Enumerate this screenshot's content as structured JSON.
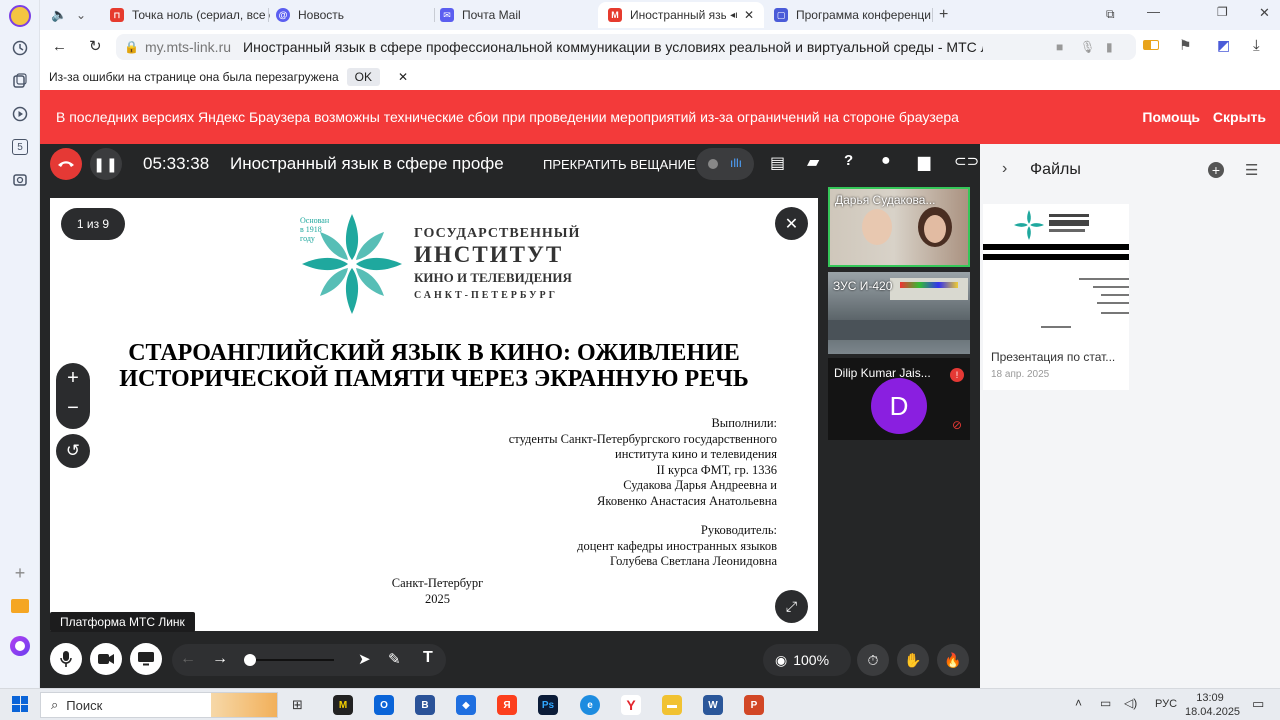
{
  "browser": {
    "tabs": [
      {
        "label": "Точка ноль (сериал, все с",
        "fav": "#e63b2e",
        "glyph": "⊓"
      },
      {
        "label": "Новость",
        "fav": "#5b5ef0",
        "glyph": "@"
      },
      {
        "label": "Почта Mail",
        "fav": "#5b5ef0",
        "glyph": "✉"
      },
      {
        "label": "Иностранный язык",
        "fav": "#e63b2e",
        "glyph": "M"
      },
      {
        "label": "Программа конференци",
        "fav": "#4a5bd8",
        "glyph": "▢"
      }
    ],
    "url_host": "my.mts-link.ru",
    "page_title": "Иностранный язык в сфере профессиональной коммуникации в условиях реальной и виртуальной среды - МТС Л...",
    "infobar_text": "Из-за ошибки на странице она была перезагружена",
    "infobar_ok": "OK",
    "sidebar_number": "5"
  },
  "banner": {
    "text": "В последних версиях Яндекс Браузера возможны технические сбои при проведении мероприятий из-за ограничений на стороне браузера",
    "help": "Помощь",
    "hide": "Скрыть"
  },
  "webinar": {
    "timer": "05:33:38",
    "title": "Иностранный язык в сфере профе",
    "stop_broadcast": "ПРЕКРАТИТЬ ВЕЩАНИЕ",
    "slide_counter": "1 из 9",
    "platform_label": "Платформа МТС Линк",
    "zoom": "100%"
  },
  "slide": {
    "logo_founded": "Основан\nв 1918\nгоду",
    "logo_l1": "ГОСУДАРСТВЕННЫЙ",
    "logo_l2": "ИНСТИТУТ",
    "logo_l3": "КИНО И ТЕЛЕВИДЕНИЯ",
    "logo_l4": "САНКТ-ПЕТЕРБУРГ",
    "title_l1": "СТАРОАНГЛИЙСКИЙ ЯЗЫК В КИНО: ОЖИВЛЕНИЕ",
    "title_l2": "ИСТОРИЧЕСКОЙ ПАМЯТИ ЧЕРЕЗ ЭКРАННУЮ РЕЧЬ",
    "authors": [
      "Выполнили:",
      "студенты Санкт-Петербургского государственного",
      "института кино и телевидения",
      "II курса ФМТ, гр. 1336",
      "Судакова Дарья Андреевна и",
      "Яковенко Анастасия Анатольевна"
    ],
    "supervisor": [
      "Руководитель:",
      "доцент кафедры иностранных языков",
      "Голубева Светлана Леонидовна"
    ],
    "city": "Санкт-Петербург",
    "year": "2025"
  },
  "participants": [
    {
      "name": "Дарья Судакова..."
    },
    {
      "name": "ЗУС И-420"
    },
    {
      "name": "Dilip Kumar Jais...",
      "initial": "D"
    }
  ],
  "files_panel": {
    "title": "Файлы",
    "file_name": "Презентация по стат...",
    "file_date": "18 апр. 2025"
  },
  "taskbar": {
    "search": "Поиск",
    "lang": "РУС",
    "time": "13:09",
    "date": "18.04.2025"
  },
  "colors": {
    "banner": "#f33a3a",
    "end_call": "#e53935",
    "avatar": "#8a1fe0",
    "active_border": "#35c759",
    "logo_teal": "#1fa89e"
  }
}
